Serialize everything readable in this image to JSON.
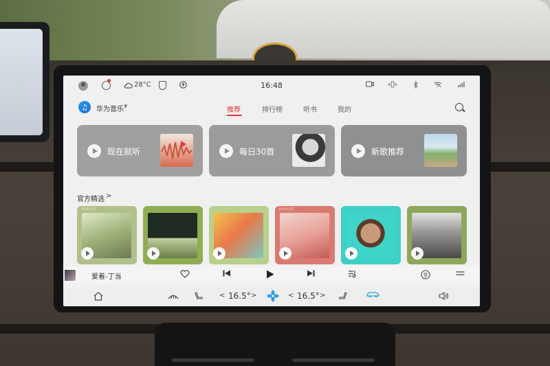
{
  "status_bar": {
    "weather_temp": "28°C",
    "time": "16:48"
  },
  "top_nav": {
    "app_name": "华为音乐",
    "tabs": [
      {
        "label": "推荐",
        "active": true
      },
      {
        "label": "排行榜",
        "active": false
      },
      {
        "label": "听书",
        "active": false
      },
      {
        "label": "我的",
        "active": false
      }
    ]
  },
  "feature_cards": [
    {
      "label": "现在就听",
      "color": "#a2a09f"
    },
    {
      "label": "每日30首",
      "color": "#9c9b9a"
    },
    {
      "label": "新歌推荐",
      "color": "#8f9190"
    }
  ],
  "section": {
    "title": "官方精选",
    "chevron": ">"
  },
  "playlists": [
    {
      "tag": "PLAYLIST",
      "bg": "#b0c08a"
    },
    {
      "tag": "",
      "bg": "#8fae52"
    },
    {
      "tag": "",
      "bg": "#b9d08c"
    },
    {
      "tag": "PLAYLIST",
      "bg": "#d97a70"
    },
    {
      "tag": "",
      "bg": "#3ed0c6"
    },
    {
      "tag": "",
      "bg": "#8ea75c"
    }
  ],
  "player": {
    "now_playing": "爱着-丁当",
    "icons": [
      "heart-icon",
      "previous-icon",
      "play-icon",
      "next-icon",
      "playlist-icon",
      "lyrics-icon",
      "menu-icon"
    ]
  },
  "bottom_bar": {
    "left_temp": "16.5°",
    "right_temp": "16.5°",
    "left_chev_l": "<",
    "left_chev_r": ">",
    "right_chev_l": "<",
    "right_chev_r": ">"
  },
  "colors": {
    "accent": "#e0383f",
    "fan": "#2a9ee0"
  }
}
